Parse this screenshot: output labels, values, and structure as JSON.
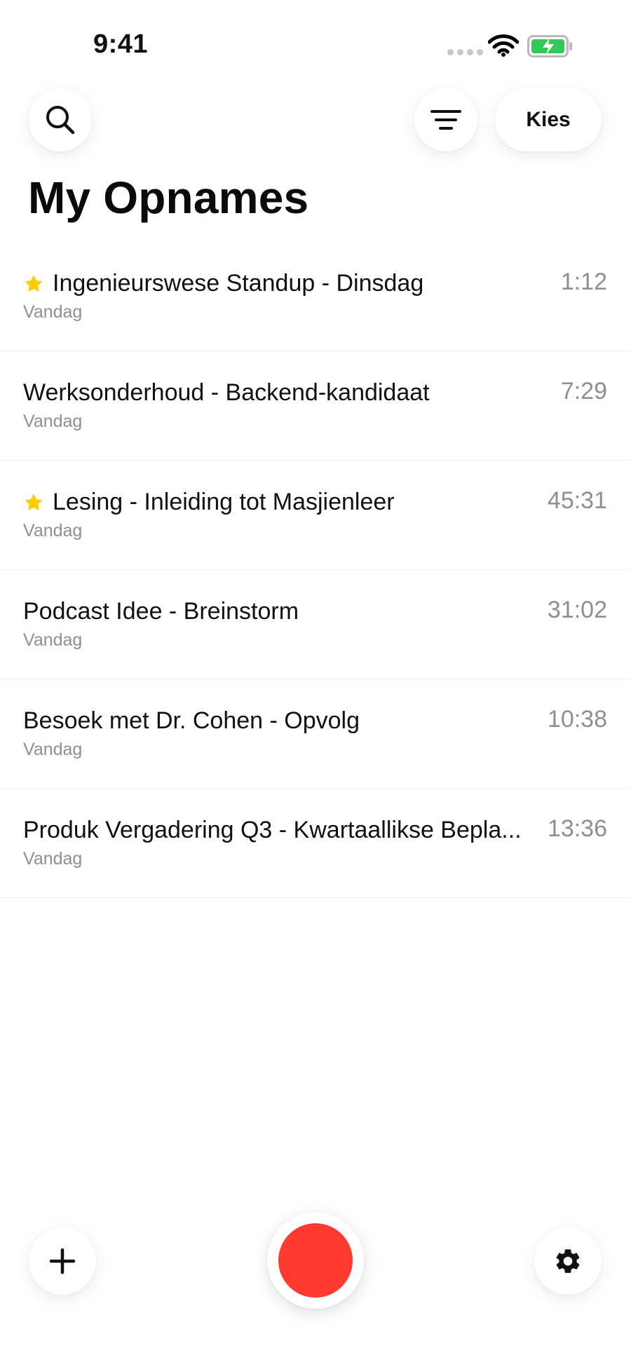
{
  "status": {
    "time": "9:41"
  },
  "header": {
    "search_icon": "search-icon",
    "filter_icon": "filter-icon",
    "select_label": "Kies",
    "title": "My Opnames"
  },
  "recordings": [
    {
      "title": "Ingenieurswese Standup - Dinsdag",
      "date": "Vandag",
      "duration": "1:12",
      "starred": true
    },
    {
      "title": "Werksonderhoud - Backend-kandidaat",
      "date": "Vandag",
      "duration": "7:29",
      "starred": false
    },
    {
      "title": "Lesing - Inleiding tot Masjienleer",
      "date": "Vandag",
      "duration": "45:31",
      "starred": true
    },
    {
      "title": "Podcast Idee - Breinstorm",
      "date": "Vandag",
      "duration": "31:02",
      "starred": false
    },
    {
      "title": "Besoek met Dr. Cohen - Opvolg",
      "date": "Vandag",
      "duration": "10:38",
      "starred": false
    },
    {
      "title": "Produk Vergadering Q3 - Kwartaallikse Bepla...",
      "date": "Vandag",
      "duration": "13:36",
      "starred": false
    }
  ],
  "footer": {
    "add_icon": "plus-icon",
    "record_icon": "record-icon",
    "settings_icon": "gear-icon"
  },
  "colors": {
    "record": "#ff3b30",
    "star": "#ffcc00",
    "battery": "#34c759"
  }
}
